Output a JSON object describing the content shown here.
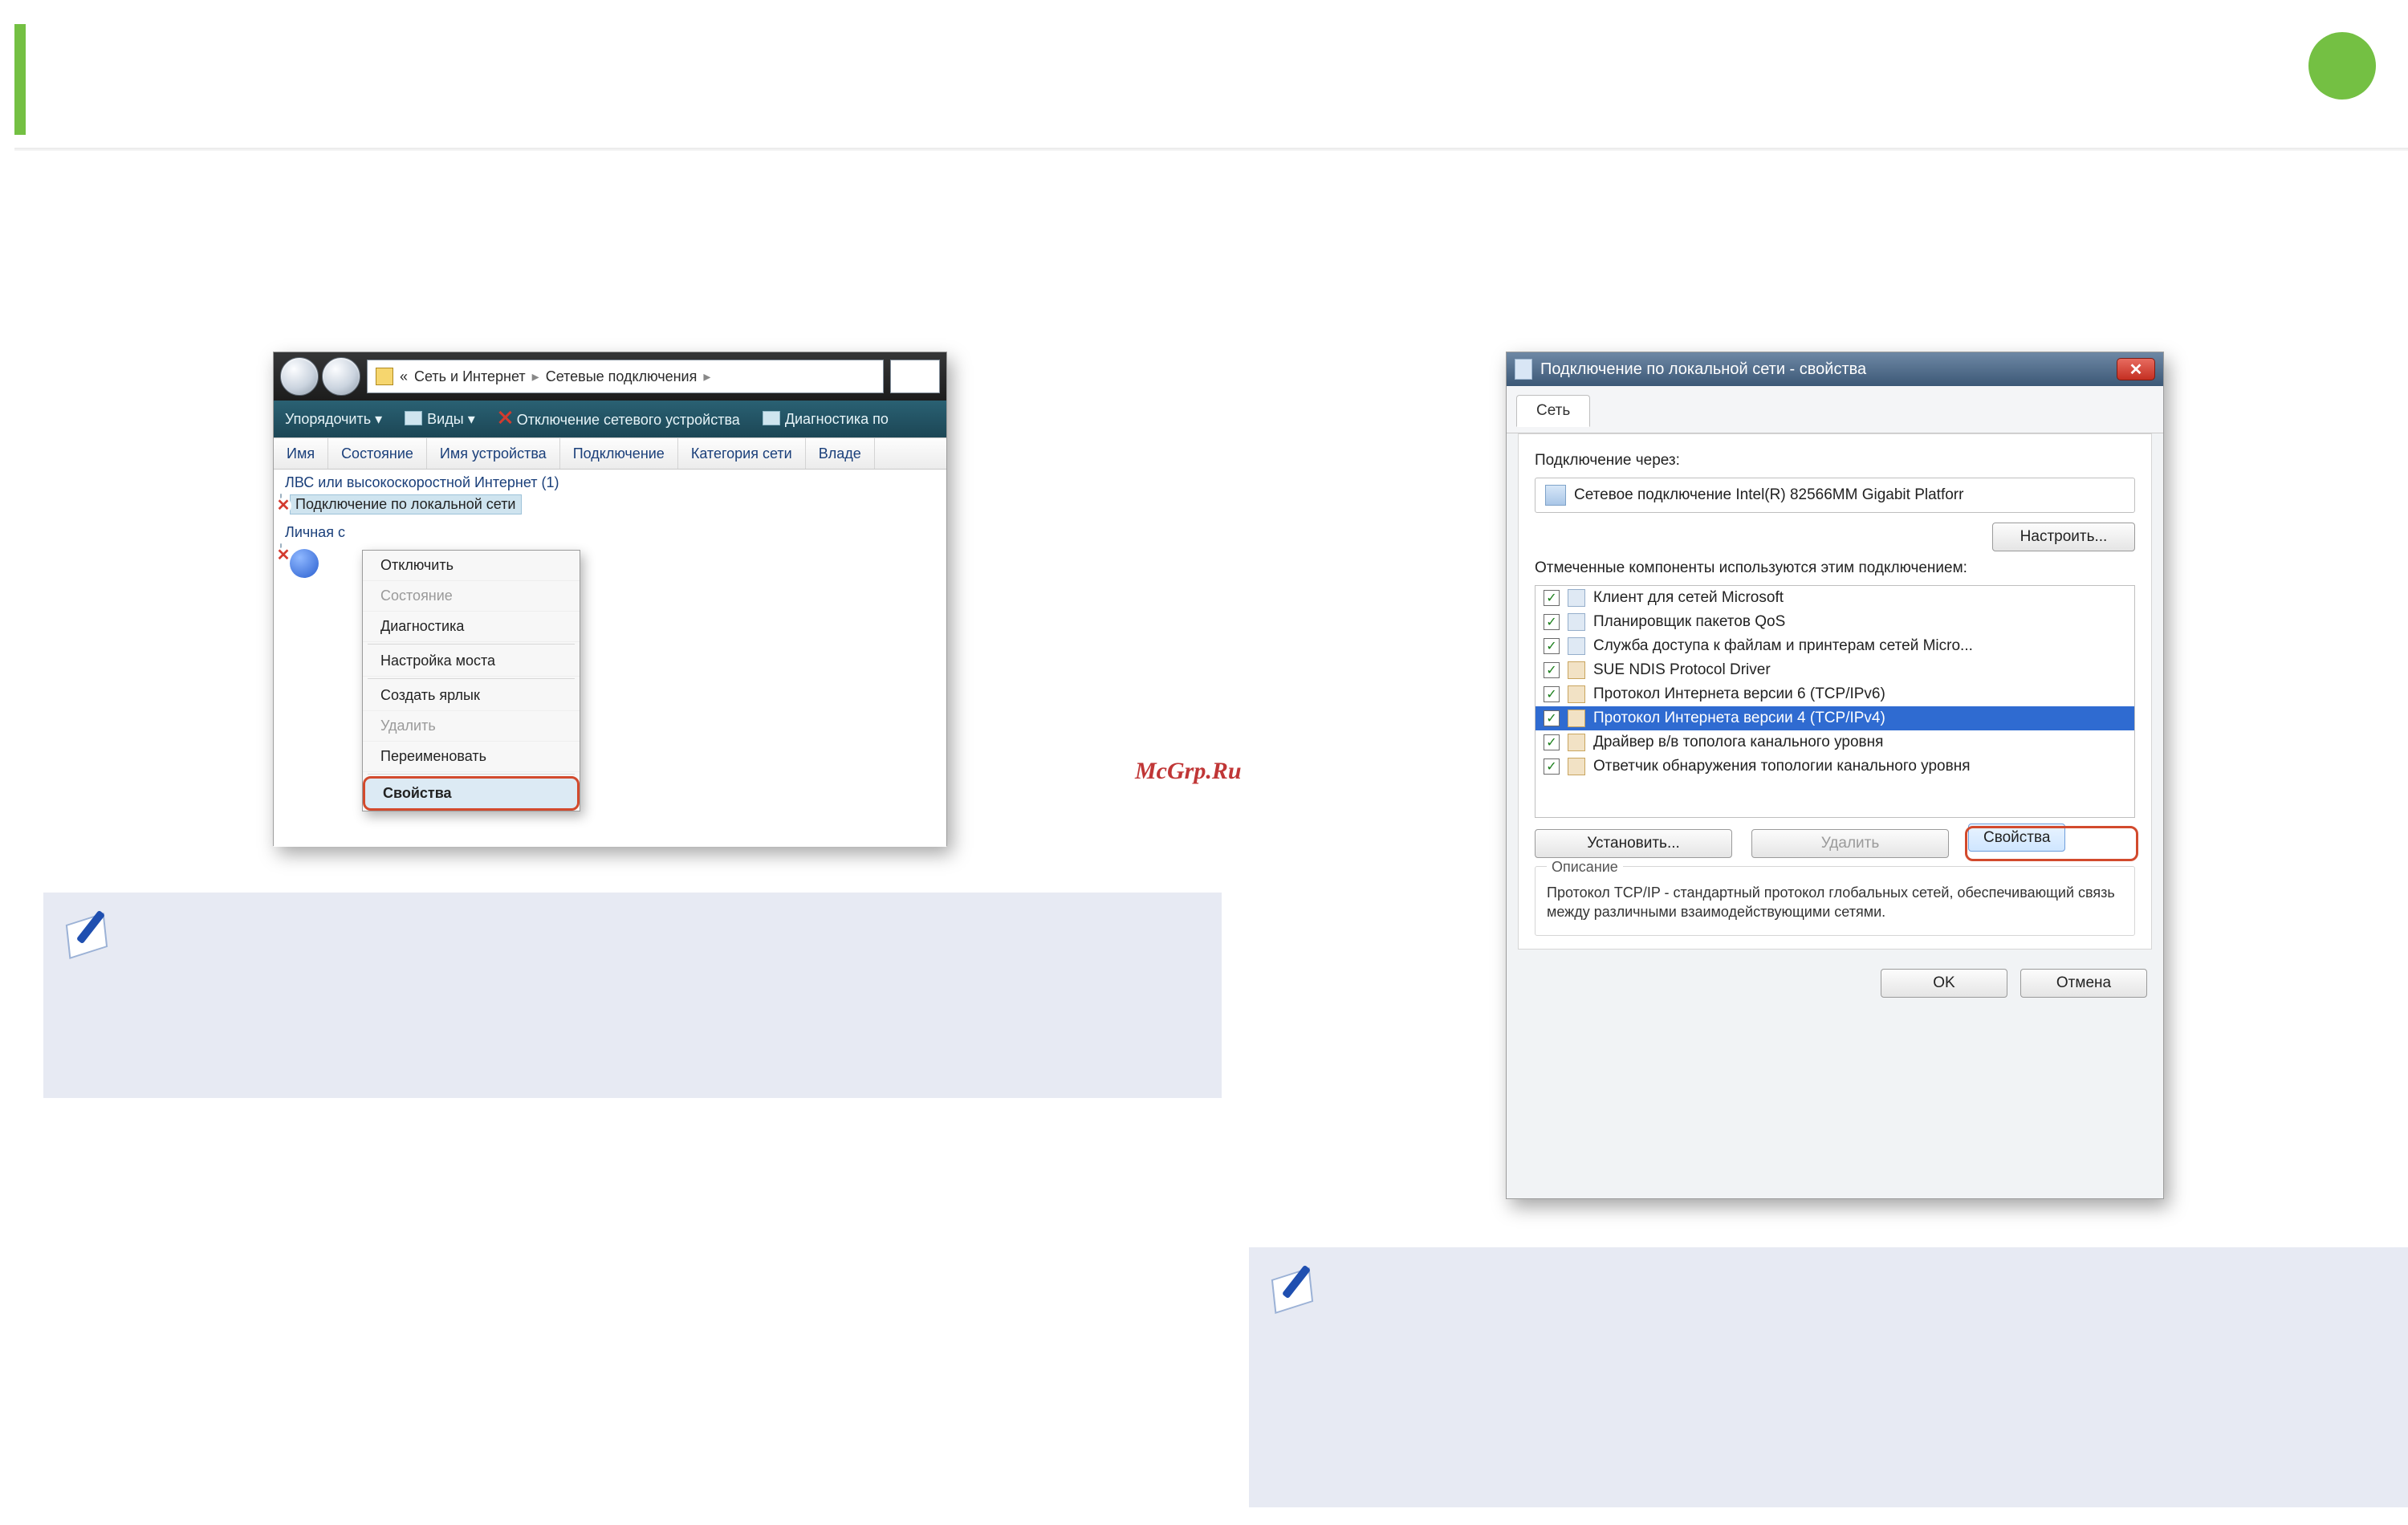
{
  "watermark": "McGrp.Ru",
  "explorer": {
    "breadcrumb_prefix": "«",
    "breadcrumb": [
      "Сеть и Интернет",
      "Сетевые подключения"
    ],
    "toolbar": {
      "organize": "Упорядочить",
      "views": "Виды",
      "disable": "Отключение сетевого устройства",
      "diagnose": "Диагностика по"
    },
    "columns": [
      "Имя",
      "Состояние",
      "Имя устройства",
      "Подключение",
      "Категория сети",
      "Владе"
    ],
    "group_label": "ЛВС или высокоскоростной Интернет (1)",
    "connection_label": "Подключение по локальной сети",
    "personal_area_label": "Личная с",
    "context_menu": {
      "disable": "Отключить",
      "status": "Состояние",
      "diagnose": "Диагностика",
      "bridge": "Настройка моста",
      "shortcut": "Создать ярлык",
      "delete": "Удалить",
      "rename": "Переименовать",
      "properties": "Свойства"
    }
  },
  "props": {
    "title": "Подключение по локальной сети - свойства",
    "tab": "Сеть",
    "connect_using_label": "Подключение через:",
    "adapter": "Сетевое подключение Intel(R) 82566MM Gigabit Platforr",
    "configure": "Настроить...",
    "components_label": "Отмеченные компоненты используются этим подключением:",
    "items": [
      {
        "label": "Клиент для сетей Microsoft",
        "icon": "net"
      },
      {
        "label": "Планировщик пакетов QoS",
        "icon": "net"
      },
      {
        "label": "Служба доступа к файлам и принтерам сетей Micro...",
        "icon": "net"
      },
      {
        "label": "SUE NDIS Protocol Driver",
        "icon": "proto"
      },
      {
        "label": "Протокол Интернета версии 6 (TCP/IPv6)",
        "icon": "proto"
      },
      {
        "label": "Протокол Интернета версии 4 (TCP/IPv4)",
        "icon": "proto",
        "selected": true
      },
      {
        "label": "Драйвер в/в тополога канального уровня",
        "icon": "proto"
      },
      {
        "label": "Ответчик обнаружения топологии канального уровня",
        "icon": "proto"
      }
    ],
    "install": "Установить...",
    "uninstall": "Удалить",
    "properties": "Свойства",
    "desc_legend": "Описание",
    "description": "Протокол TCP/IP - стандартный протокол глобальных сетей, обеспечивающий связь между различными взаимодействующими сетями.",
    "ok": "OK",
    "cancel": "Отмена"
  }
}
